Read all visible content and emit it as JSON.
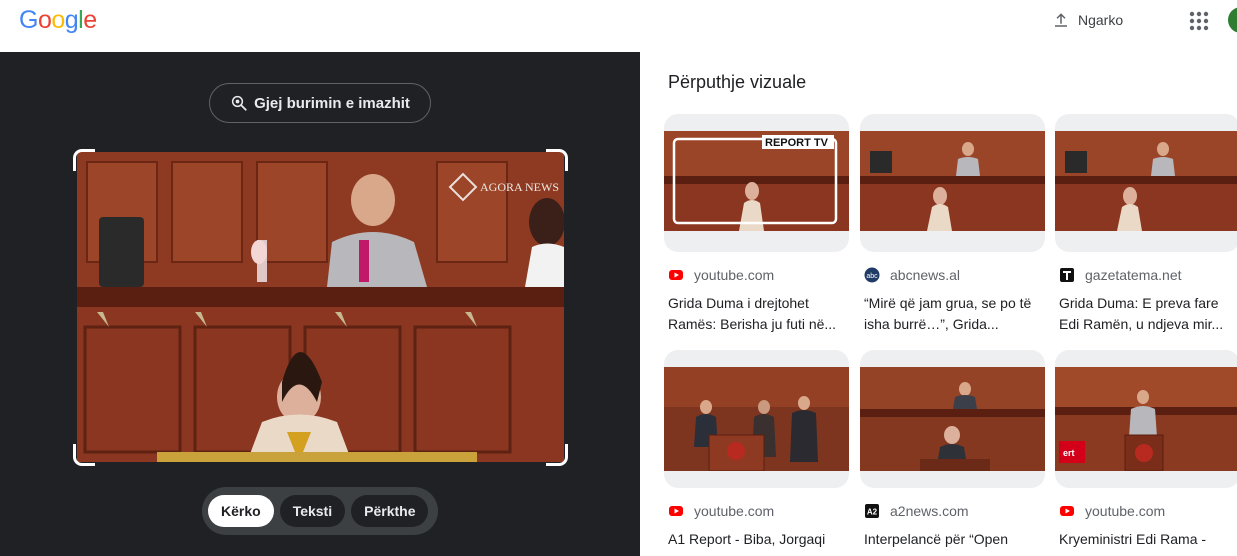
{
  "header": {
    "logo_letters": [
      "G",
      "o",
      "o",
      "g",
      "l",
      "e"
    ],
    "logo_colors": [
      "#4285f4",
      "#ea4335",
      "#fbbc05",
      "#4285f4",
      "#34a853",
      "#ea4335"
    ],
    "upload_label": "Ngarko"
  },
  "left": {
    "find_source_label": "Gjej burimin e imazhit",
    "watermark": "AGORA NEWS",
    "tabs": [
      {
        "label": "Kërko",
        "active": true
      },
      {
        "label": "Teksti",
        "active": false
      },
      {
        "label": "Përkthe",
        "active": false
      }
    ]
  },
  "results": {
    "title": "Përputhje vizuale",
    "items": [
      {
        "site": "youtube.com",
        "favicon": "youtube-icon",
        "title": "Grida Duma i drejtohet Ramës: Berisha ju futi në..."
      },
      {
        "site": "abcnews.al",
        "favicon": "abc-icon",
        "title": "“Mirë që jam grua, se po të isha burrë…”, Grida..."
      },
      {
        "site": "gazetatema.net",
        "favicon": "tema-icon",
        "title": "Grida Duma: E preva fare Edi Ramën, u ndjeva mir..."
      },
      {
        "site": "youtube.com",
        "favicon": "youtube-icon",
        "title": "A1 Report - Biba, Jorgaqi"
      },
      {
        "site": "a2news.com",
        "favicon": "a2-icon",
        "title": "Interpelancë për “Open"
      },
      {
        "site": "youtube.com",
        "favicon": "youtube-icon",
        "title": "Kryeministri Edi Rama -"
      }
    ],
    "overlay_report": "REPORT TV"
  },
  "colors": {
    "dark_bg": "#202124",
    "wood": "#8b3a22",
    "youtube_red": "#ff0000"
  }
}
